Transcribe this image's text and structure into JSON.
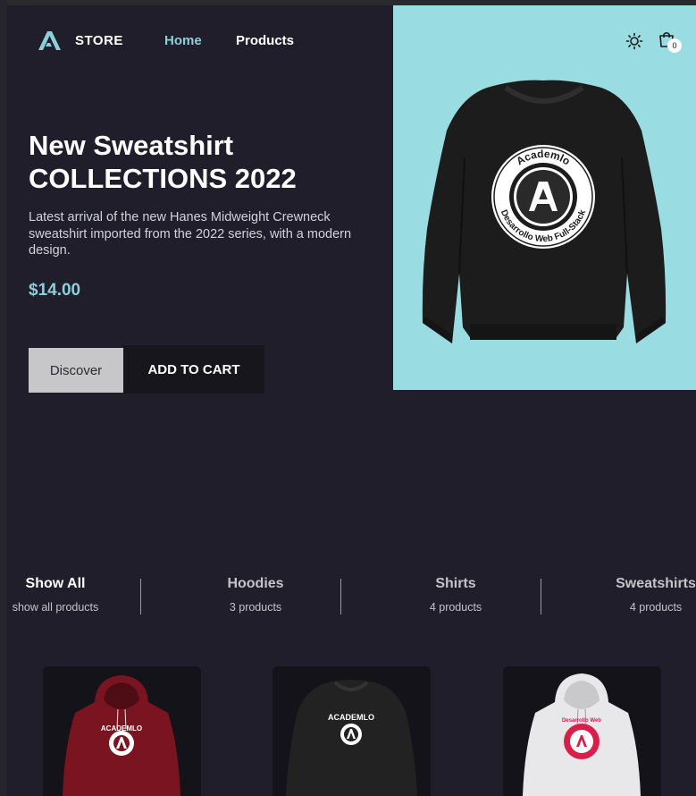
{
  "header": {
    "brand": "STORE",
    "nav": [
      {
        "label": "Home",
        "active": true
      },
      {
        "label": "Products",
        "active": false
      }
    ],
    "cart_count": "0",
    "icons": [
      "logo-icon",
      "sun-icon",
      "shopping-bag-icon"
    ]
  },
  "hero": {
    "title_line1": "New Sweatshirt",
    "title_line2": "COLLECTIONS 2022",
    "description": "Latest arrival of the new Hanes Midweight Crewneck sweatshirt imported from the 2022 series, with a modern design.",
    "price": "$14.00",
    "discover_label": "Discover",
    "add_to_cart_label": "ADD TO CART",
    "image": {
      "background": "#99dde2",
      "garment_color": "#1c1c1c",
      "badge_top_text": "Academlo",
      "badge_bottom_text": "Desarrollo Web Full-Stack"
    }
  },
  "filters": [
    {
      "title": "Show All",
      "count": "show all products",
      "active": true
    },
    {
      "title": "Hoodies",
      "count": "3 products",
      "active": false
    },
    {
      "title": "Shirts",
      "count": "4 products",
      "active": false
    },
    {
      "title": "Sweatshirts",
      "count": "4 products",
      "active": false
    }
  ],
  "products": [
    {
      "color": "#7a1420",
      "badge_text": "ACADEMLO",
      "type": "hoodie"
    },
    {
      "color": "#222222",
      "badge_text": "ACADEMLO",
      "type": "sweatshirt"
    },
    {
      "color": "#e8e8ea",
      "badge_text": "Desarrollo Web",
      "type": "hoodie"
    }
  ],
  "colors": {
    "background": "#1f1e2a",
    "accent": "#8dcfd8",
    "button_light": "#c7c7c9",
    "button_dark": "#16161c"
  }
}
